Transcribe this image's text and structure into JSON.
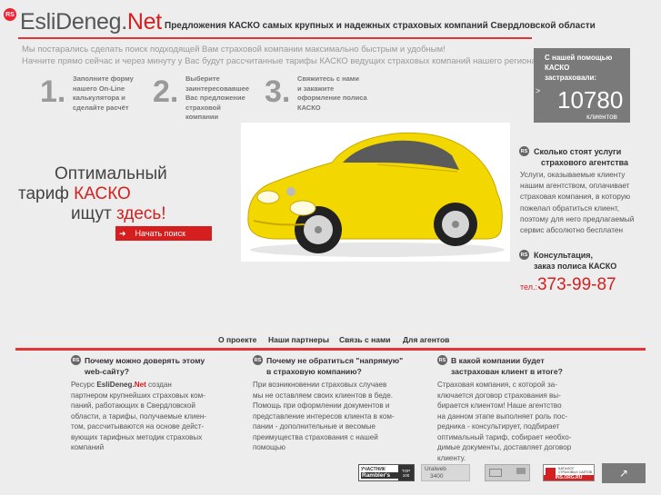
{
  "header": {
    "logo_badge": "RS",
    "logo_main": "EsliDeneg.",
    "logo_accent": "Net",
    "subtitle": "Предложения КАСКО самых крупных и надежных страховых компаний Свердловской области"
  },
  "intro": {
    "line1": "Мы постарались сделать поиск подходящей Вам страховой компании максимально быстрым и удобным!",
    "line2": "Начните прямо сейчас и через минуту у Вас будут рассчитанные тарифы КАСКО ведущих страховых компаний нашего региона"
  },
  "steps": [
    {
      "num": "1.",
      "lines": [
        "Заполните форму",
        "нашего On-Line",
        "калькулятора и",
        "сделайте расчёт"
      ]
    },
    {
      "num": "2.",
      "lines": [
        "Выберите",
        "заинтересовавшее",
        "Вас предложение",
        "страховой",
        "компании"
      ]
    },
    {
      "num": "3.",
      "lines": [
        "Свяжитесь с нами",
        "и закажите",
        "оформление полиса",
        "КАСКО"
      ]
    }
  ],
  "counter": {
    "caption": [
      "С нашей помощью",
      "КАСКО",
      "застраховали:"
    ],
    "arrow": ">",
    "value": "10780",
    "unit": "клиентов"
  },
  "tagline": {
    "line1": "Оптимальный",
    "line2_a": "тариф ",
    "line2_b": "КАСКО",
    "line3_a": "ищут ",
    "line3_b": "здесь!",
    "button_arrow": "➜",
    "button": "Начать поиск"
  },
  "agency": {
    "badge": "RS",
    "title": [
      "Сколько стоят услуги",
      "страхового агентства"
    ],
    "text": [
      "Услуги, оказываемые клиенту",
      "нашим агентством, оплачивает",
      "страховая компания, в которую",
      "пожелал обратиться клиент,",
      "поэтому для него предлагаемый",
      "сервис абсолютно бесплатен"
    ]
  },
  "consult": {
    "badge": "RS",
    "title": [
      "Консультация,",
      "заказ полиса КАСКО"
    ],
    "phone_label": "тел.:",
    "phone": "373-99-87"
  },
  "nav": {
    "about": "О проекте",
    "partners": "Наши партнеры",
    "contact": "Связь с нами",
    "agents": "Для агентов"
  },
  "columns": [
    {
      "badge": "RS",
      "title": [
        "Почему можно доверять этому",
        "web-сайту?"
      ],
      "text_first": [
        "Ресурс ",
        "EsliDeneg.",
        "Net",
        " создан"
      ],
      "text": [
        "партнером крупнейших страховых ком-",
        "паний, работающих в Свердловской",
        "области, а тарифы, получаемые клиен-",
        "том, рассчитываются на основе дейст-",
        "вующих тарифных методик страховых",
        "компаний"
      ]
    },
    {
      "badge": "RS",
      "title": [
        "Почему не обратиться \"напрямую\"",
        "в страховую компанию?"
      ],
      "text": [
        "При возникновении страховых случаев",
        "мы не оставляем своих клиентов в беде.",
        "Помощь при оформлении документов и",
        "представление интересов клиента в ком-",
        "пании - дополнительные и весомые",
        "преимущества страхования с нашей",
        "помощью"
      ]
    },
    {
      "badge": "RS",
      "title": [
        "В какой компании будет",
        "застрахован клиент в итоге?"
      ],
      "text": [
        "Страховая компания, с которой за-",
        "ключается договор страхования вы-",
        "бирается клиентом! Наше агентство",
        "на данном этапе выполняет роль пос-",
        "редника - консультирует, подбирает",
        "оптимальный тариф, собирает необхо-",
        "димые документы, доставляет договор",
        "клиенту."
      ]
    }
  ],
  "footer": {
    "rambler_top": "УЧАСТНИК",
    "rambler_brand": "Rambler's",
    "rambler_badge": "TOP 100",
    "uralweb_name": "Uralweb",
    "uralweb_value": "3400",
    "catalog_top": "КАТАЛОГ",
    "catalog_mid": "СТРАХОВЫХ САЙТОВ",
    "catalog_site": "INS.ORG.RU",
    "corner_icon": "↗"
  }
}
